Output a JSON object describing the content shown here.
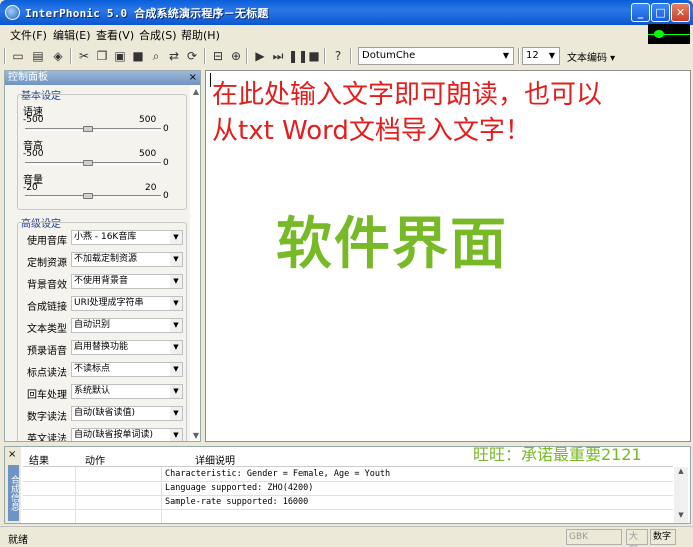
{
  "window": {
    "title": "InterPhonic 5.0 合成系统演示程序－无标题",
    "buttons": {
      "minimize": "_",
      "maximize": "□",
      "close": "✕"
    }
  },
  "menu": {
    "file": "文件(F)",
    "edit": "编辑(E)",
    "view": "查看(V)",
    "synth": "合成(S)",
    "help": "帮助(H)"
  },
  "toolbar": {
    "font": "DotumChe",
    "size": "12",
    "encoding": "文本编码",
    "icons": [
      "new-icon",
      "open-icon",
      "save-icon",
      "cut-icon",
      "copy-icon",
      "paste-icon",
      "color-icon",
      "find-icon",
      "replace-icon",
      "replace-all-icon",
      "zoom-out-icon",
      "zoom-in-icon",
      "play-icon",
      "play-next-icon",
      "pause-icon",
      "stop-icon",
      "help-icon"
    ]
  },
  "control_panel": {
    "title": "控制面板",
    "basic_title": "基本设定",
    "speed": {
      "label": "语速",
      "min": "-500",
      "max": "500",
      "value": "0"
    },
    "pitch": {
      "label": "音高",
      "min": "-500",
      "max": "500",
      "value": "0"
    },
    "volume": {
      "label": "音量",
      "min": "-20",
      "max": "20",
      "value": "0"
    },
    "advanced_title": "高级设定",
    "props": [
      {
        "label": "使用音库",
        "value": "小燕 - 16K音库"
      },
      {
        "label": "定制资源",
        "value": "不加载定制资源"
      },
      {
        "label": "背景音效",
        "value": "不使用背景音"
      },
      {
        "label": "合成链接",
        "value": "URI处理成字符串"
      },
      {
        "label": "文本类型",
        "value": "自动识别"
      },
      {
        "label": "预录语音",
        "value": "启用替换功能"
      },
      {
        "label": "标点读法",
        "value": "不读标点"
      },
      {
        "label": "回车处理",
        "value": "系统默认"
      },
      {
        "label": "数字读法",
        "value": "自动(缺省读值)"
      },
      {
        "label": "英文读法",
        "value": "自动(缺省按单词读)"
      }
    ]
  },
  "editor": {
    "line1": "在此处输入文字即可朗读，也可以",
    "line2": "从txt Word文档导入文字！",
    "watermark": "软件界面"
  },
  "output": {
    "side_tab": "合成信息",
    "columns": {
      "result": "结果",
      "action": "动作",
      "detail": "详细说明"
    },
    "logs": [
      "Characteristic: Gender = Female, Age = Youth",
      "Language supported: ZHO(4200)",
      "Sample-rate supported: 16000"
    ],
    "promo": "旺旺：承诺最重要2121"
  },
  "status": {
    "text": "就绪",
    "gbk": "GBK",
    "caps": "大写",
    "num": "数字"
  }
}
